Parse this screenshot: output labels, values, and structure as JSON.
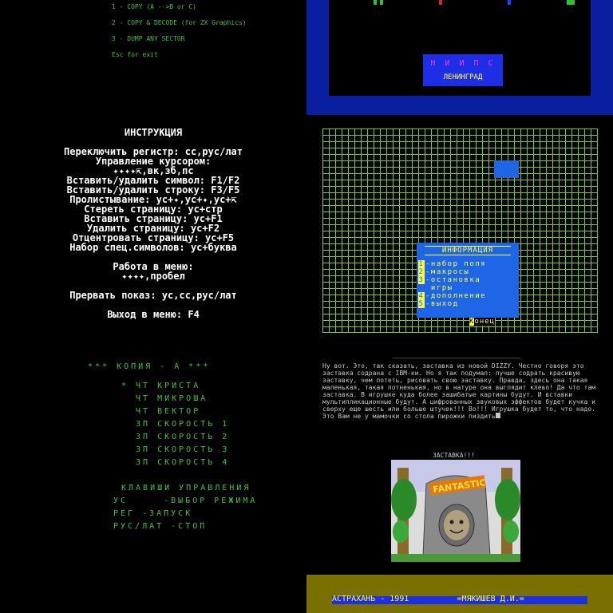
{
  "copy_menu": {
    "items": [
      "1 - COPY (A -->B or C)",
      "2 - COPY & DECODE (for ZX Graphics)",
      "3 - DUMP ANY SECTOR",
      "Esc for exit"
    ]
  },
  "sign": {
    "line1": "Н И И   П С",
    "line2": "ЛЕНИНГРАД"
  },
  "instructions": {
    "title": "ИНСТРУКЦИЯ",
    "lines": [
      "Переключить регистр: сс,рус/лат",
      "Управление курсором:",
      "✦✦✦✦⇱,вк,зб,пс",
      "Вставить/удалить символ: F1/F2",
      "Вставить/удалить строку: F3/F5",
      "Пролистывание: ус+✦,ус+✦,ус+⇱",
      "Стереть страницу: ус+стр",
      "Вставить страницу: ус+F1",
      "Удалить страницу: ус+F2",
      "Отцентровать страницу: ус+F5",
      "Набор спец.символов: ус+буква",
      "Работа в меню:",
      "✦✦✦✦,пробел",
      "Прервать показ: ус,сс,рус/лат",
      "Выход в меню: F4"
    ]
  },
  "info_menu": {
    "title": "ИНФОРМАЦИЯ",
    "items": [
      {
        "num": "1",
        "label": "-набор поля"
      },
      {
        "num": "2",
        "label": "-макросы"
      },
      {
        "num": "3",
        "label": "-остановка"
      },
      {
        "num": "",
        "label": " игры"
      },
      {
        "num": "4",
        "label": "-дополнение"
      },
      {
        "num": "5",
        "label": "-выход"
      }
    ],
    "end_key": "К",
    "end_label": "онец"
  },
  "copy_a": {
    "title": "*** КОПИЯ - А ***",
    "options": [
      "* ЧТ КРИСТА",
      "  ЧТ МИКРОША",
      "  ЧТ ВЕКТОР",
      "  ЗП СКОРОСТЬ 1",
      "  ЗП СКОРОСТЬ 2",
      "  ЗП СКОРОСТЬ 3",
      "  ЗП СКОРОСТЬ 4"
    ],
    "keys_title": "КЛАВИШИ УПРАВЛЕНИЯ",
    "keys": [
      "УС     -ВЫБОР РЕЖИМА",
      "РЕГ -ЗАПУСК",
      "РУС/ЛАТ -СТОП"
    ]
  },
  "dizzy": {
    "text": "Ну вот. Это, так сказать, заставка из новой DIZZY. Честно говоря это заставка содрана с IBM-ки. Но я так подумал: лучше  содрать красивую заставку, чем потеть, рисовать свою заставку. Правда, здесь она  такая маленькая, такая  потненькая, но в натуре она выглядит  клево! Да что там заставка. В игрушке  куда  более зашибатые картины будут. И вставки мультипликационные будут. А цифрованных звуковых эффектов будет кучка и сверху еще шесть или больше штучек!!!  Во!!! Игрушка будет то, что надо. Это Вам не у мамочки со стола пирожки пиздить",
    "caption": "ЗАСТАВКА!!!",
    "logo_text": "FANTASTIC"
  },
  "footer": {
    "text": "АСТРАХАНЬ - 1991          =МЯКИШЕВ Д.И.="
  }
}
